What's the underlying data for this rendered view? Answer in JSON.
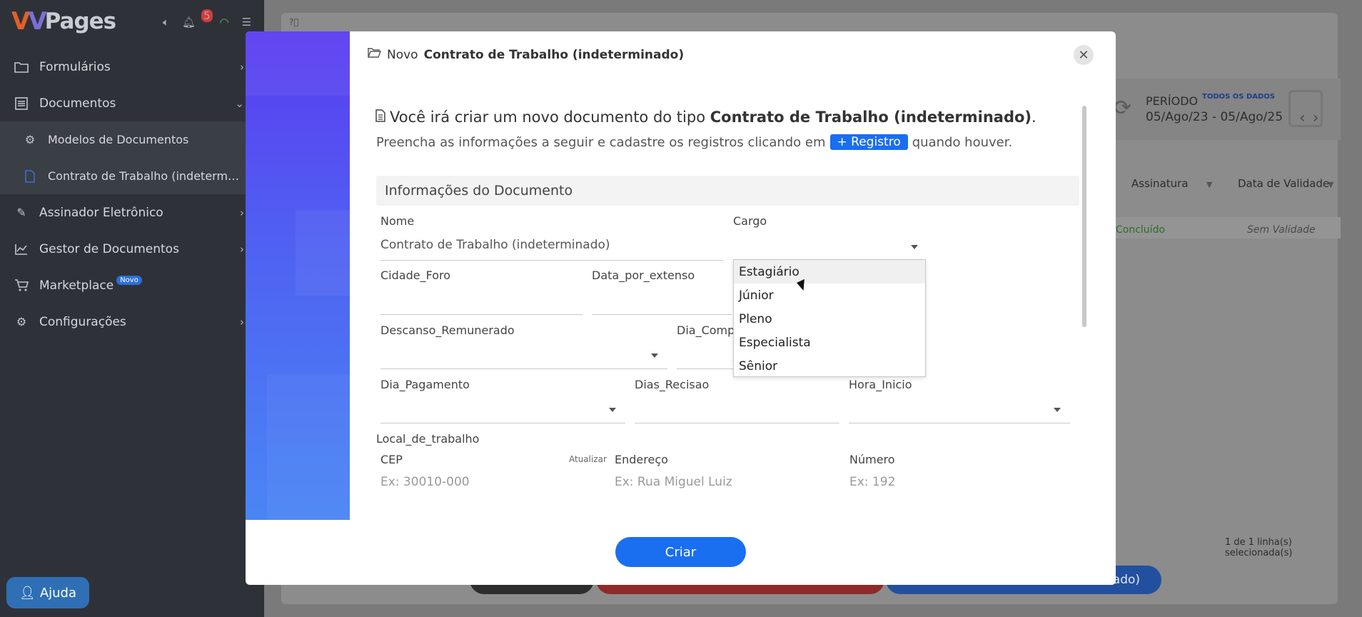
{
  "app": {
    "logo_text": "Pages",
    "notification_count": "5"
  },
  "sidebar": {
    "items": [
      {
        "label": "Formulários"
      },
      {
        "label": "Documentos"
      },
      {
        "label": "Modelos de Documentos"
      },
      {
        "label": "Contrato de Trabalho (indetermina..."
      },
      {
        "label": "Assinador Eletrônico"
      },
      {
        "label": "Gestor de Documentos"
      },
      {
        "label": "Marketplace",
        "badge": "Novo"
      },
      {
        "label": "Configurações"
      }
    ],
    "help_label": "Ajuda"
  },
  "background": {
    "periodo_label": "PERÍODO",
    "todos_label": "TODOS OS DADOS",
    "period_dates": "05/Ago/23 - 05/Ago/25",
    "columns": [
      "Assinatura",
      "Data de Validade"
    ],
    "row": {
      "status": "Concluído",
      "validade": "Sem Validade"
    },
    "selection_text": "1 de 1 linha(s) selecionada(s)",
    "button_fragment": "nado)"
  },
  "modal": {
    "title_prefix": "Novo",
    "title_bold": "Contrato de Trabalho (indeterminado)",
    "intro": {
      "line1_prefix": "Você irá criar um novo documento do tipo",
      "line1_bold": "Contrato de Trabalho (indeterminado)",
      "line1_suffix": ".",
      "line2_prefix": "Preencha as informações a seguir e cadastre os registros clicando em",
      "register_button": "+ Registro",
      "line2_suffix": "quando houver."
    },
    "section_title": "Informações do Documento",
    "fields": {
      "nome": {
        "label": "Nome",
        "value": "Contrato de Trabalho (indeterminado)"
      },
      "cargo": {
        "label": "Cargo",
        "value": ""
      },
      "cidade_foro": {
        "label": "Cidade_Foro",
        "value": ""
      },
      "data_por_extenso": {
        "label": "Data_por_extenso",
        "value": ""
      },
      "descanso_remunerado": {
        "label": "Descanso_Remunerado",
        "value": ""
      },
      "dia_compe": {
        "label": "Dia_Compe",
        "value": ""
      },
      "dia_pagamento": {
        "label": "Dia_Pagamento",
        "value": ""
      },
      "dias_recisao": {
        "label": "Dias_Recisao",
        "value": ""
      },
      "hora_inicio": {
        "label": "Hora_Inicio",
        "value": ""
      },
      "local_de_trabalho": {
        "label": "Local_de_trabalho"
      },
      "cep": {
        "label": "CEP",
        "placeholder": "Ex: 30010-000",
        "action": "Atualizar"
      },
      "endereco": {
        "label": "Endereço",
        "placeholder": "Ex: Rua Miguel Luiz"
      },
      "numero": {
        "label": "Número",
        "placeholder": "Ex: 192"
      }
    },
    "cargo_options": [
      "Estagiário",
      "Júnior",
      "Pleno",
      "Especialista",
      "Sênior"
    ],
    "submit_label": "Criar"
  }
}
